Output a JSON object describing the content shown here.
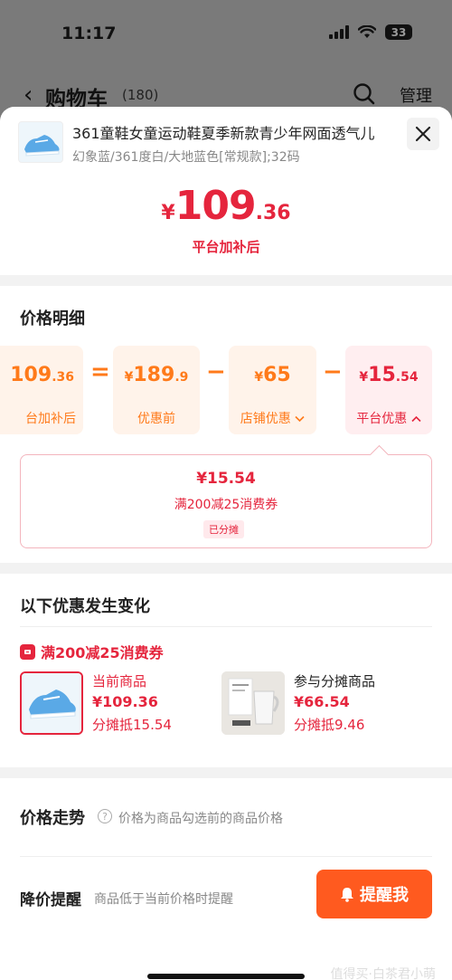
{
  "status_bar": {
    "time": "11:17",
    "battery": "33"
  },
  "background_header": {
    "back_icon": "chevron-left-icon",
    "title": "购物车",
    "count": "(180)",
    "search_icon": "search-icon",
    "manage_label": "管理"
  },
  "product": {
    "name": "361童鞋女童运动鞋夏季新款青少年网面透气儿",
    "spec": "幻象蓝/361度白/大地蓝色[常规款];32码",
    "price_symbol": "¥",
    "price_int": "109",
    "price_dec": ".36",
    "price_note": "平台加补后"
  },
  "price_detail": {
    "title": "价格明细",
    "final": {
      "int": "109",
      "dec": ".36",
      "label": "台加补后"
    },
    "op_equal": "=",
    "op_minus": "−",
    "before": {
      "symbol": "¥",
      "int": "189",
      "dec": ".9",
      "label": "优惠前"
    },
    "shop": {
      "symbol": "¥",
      "int": "65",
      "dec": "",
      "label": "店铺优惠",
      "icon": "chevron-down-icon"
    },
    "platform": {
      "symbol": "¥",
      "int": "15",
      "dec": ".54",
      "label": "平台优惠",
      "icon": "chevron-up-icon"
    },
    "coupon_card": {
      "amount": "¥15.54",
      "name": "满200减25消费券",
      "tag": "已分摊"
    }
  },
  "changes": {
    "title": "以下优惠发生变化",
    "coupon_label": "满200减25消费券",
    "current": {
      "label": "当前商品",
      "price": "¥109.36",
      "share": "分摊抵15.54"
    },
    "related": {
      "label": "参与分摊商品",
      "price": "¥66.54",
      "share": "分摊抵9.46"
    }
  },
  "trend": {
    "title": "价格走势",
    "help_icon": "question-icon",
    "note": "价格为商品勾选前的商品价格"
  },
  "remind": {
    "title": "降价提醒",
    "note": "商品低于当前价格时提醒",
    "button": "提醒我",
    "bell_icon": "bell-icon"
  },
  "watermark": "值得买·白茶君小萌",
  "colors": {
    "accent_red": "#e5253d",
    "accent_orange": "#ff7a1a",
    "button_orange": "#ff5a1f"
  }
}
